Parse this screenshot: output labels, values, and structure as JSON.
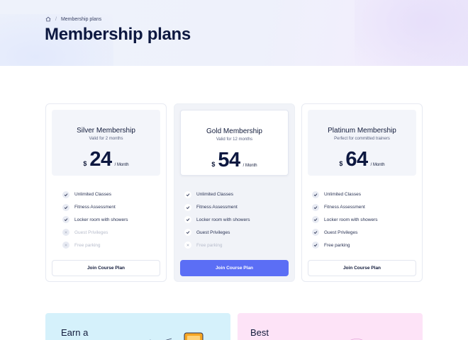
{
  "breadcrumb": {
    "home_icon": "home-icon",
    "current": "Membership plans"
  },
  "page": {
    "title": "Membership plans"
  },
  "colors": {
    "accent": "#5b6ef5",
    "title": "#0d1840",
    "muted": "#b7bccb"
  },
  "plans": [
    {
      "name": "Silver Membership",
      "validity": "Valid for 2 months",
      "currency": "$",
      "price": "24",
      "period": "/ Month",
      "features": [
        {
          "label": "Unlimited Classes",
          "included": true
        },
        {
          "label": "Fitness Assessment",
          "included": true
        },
        {
          "label": "Locker room with showers",
          "included": true
        },
        {
          "label": "Guest Privileges",
          "included": false
        },
        {
          "label": "Free parking",
          "included": false
        }
      ],
      "button": "Join Course Plan"
    },
    {
      "name": "Gold Membership",
      "validity": "Valid for 12 months",
      "currency": "$",
      "price": "54",
      "period": "/ Month",
      "features": [
        {
          "label": "Unlimited Classes",
          "included": true
        },
        {
          "label": "Fitness Assessment",
          "included": true
        },
        {
          "label": "Locker room with showers",
          "included": true
        },
        {
          "label": "Guest Privileges",
          "included": true
        },
        {
          "label": "Free parking",
          "included": false
        }
      ],
      "button": "Join Course Plan"
    },
    {
      "name": "Platinum Membership",
      "validity": "Perfect for committed trainers",
      "currency": "$",
      "price": "64",
      "period": "/ Month",
      "features": [
        {
          "label": "Unlimited Classes",
          "included": true
        },
        {
          "label": "Fitness Assessment",
          "included": true
        },
        {
          "label": "Locker room with showers",
          "included": true
        },
        {
          "label": "Guest Privileges",
          "included": true
        },
        {
          "label": "Free parking",
          "included": true
        }
      ],
      "button": "Join Course Plan"
    }
  ],
  "promos": [
    {
      "text": "Earn a",
      "color": "#d5f1fb"
    },
    {
      "text": "Best",
      "color": "#fde3f7"
    }
  ]
}
